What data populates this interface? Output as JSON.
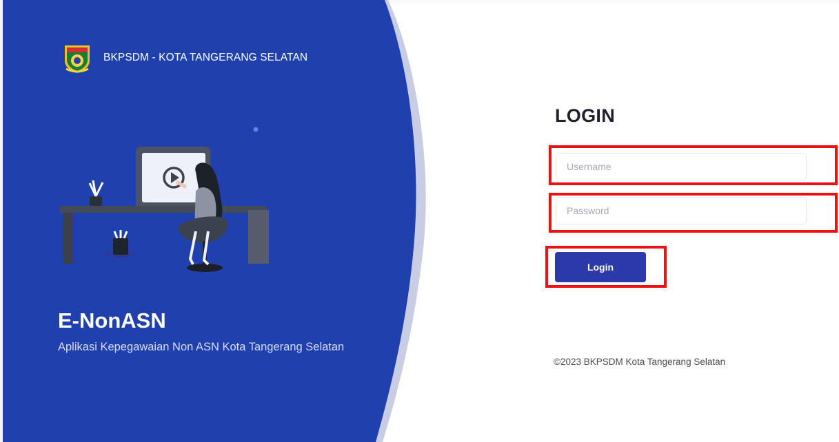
{
  "brand": {
    "name": "BKPSDM - KOTA TANGERANG SELATAN",
    "logo_icon": "city-emblem-icon"
  },
  "hero": {
    "app_title": "E-NonASN",
    "app_subtitle": "Aplikasi Kepegawaian Non ASN Kota Tangerang Selatan",
    "illustration": "woman-at-desk-watching-video-illustration"
  },
  "login": {
    "title": "LOGIN",
    "username_placeholder": "Username",
    "username_value": "",
    "password_placeholder": "Password",
    "password_value": "",
    "submit_label": "Login"
  },
  "footer": {
    "copyright": "©2023 BKPSDM Kota Tangerang Selatan"
  },
  "colors": {
    "panel": "#2040ad",
    "panel_curve_shadow": "#c9cde3",
    "button": "#2b3aa8",
    "highlight": "#ee1111"
  }
}
